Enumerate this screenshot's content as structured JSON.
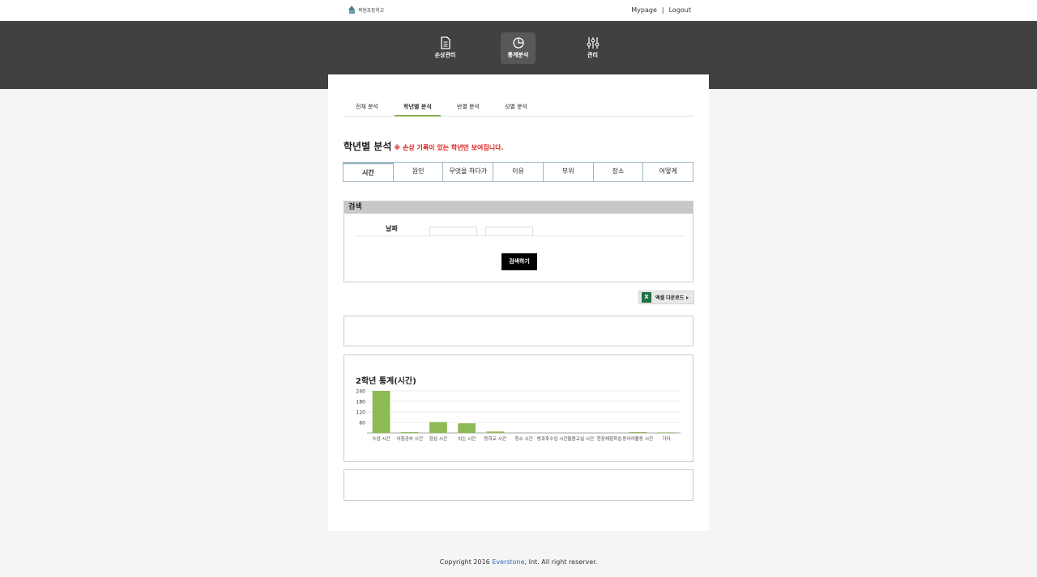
{
  "header": {
    "logo_text": "목현초등학교",
    "links": [
      "Mypage",
      "Logout"
    ],
    "separator": "|"
  },
  "nav": [
    {
      "label": "손상관리",
      "icon": "document-icon",
      "active": false
    },
    {
      "label": "통계분석",
      "icon": "pie-chart-icon",
      "active": true
    },
    {
      "label": "관리",
      "icon": "sliders-icon",
      "active": false
    }
  ],
  "tabs": [
    "전체 분석",
    "학년별 분석",
    "반별 분석",
    "성별 분석"
  ],
  "section": {
    "title": "학년별 분석",
    "note": "※ 손상 기록이 있는 학년만 보여집니다."
  },
  "subtabs": [
    "시간",
    "원인",
    "무엇을 하다가",
    "이유",
    "부위",
    "장소",
    "어떻게"
  ],
  "search": {
    "header": "검색",
    "date_label": "날짜",
    "from_value": "",
    "to_value": "",
    "tilde": "~",
    "button": "검색하기"
  },
  "excel": {
    "icon_letter": "X",
    "label": "엑셀 다운로드"
  },
  "chart_data": {
    "type": "bar",
    "title": "2학년 통계(시간)",
    "categories": [
      "수업 시간",
      "아침공부 시간",
      "점심 시간",
      "쉬는 시간",
      "등하교 시간",
      "청소 시간",
      "방과후수업 시간",
      "돌봄교실 시간",
      "현장체험학습",
      "동아리활동 시간",
      "기타"
    ],
    "values": [
      240,
      5,
      62,
      55,
      8,
      0,
      0,
      0,
      0,
      5,
      3
    ],
    "yticks": [
      60,
      120,
      180,
      240
    ],
    "ylim": [
      0,
      240
    ],
    "color": "#8dba56"
  },
  "footer": {
    "prefix": "Copyright 2016 ",
    "brand": "Everstone",
    "suffix": ", Int. All right reserver."
  }
}
